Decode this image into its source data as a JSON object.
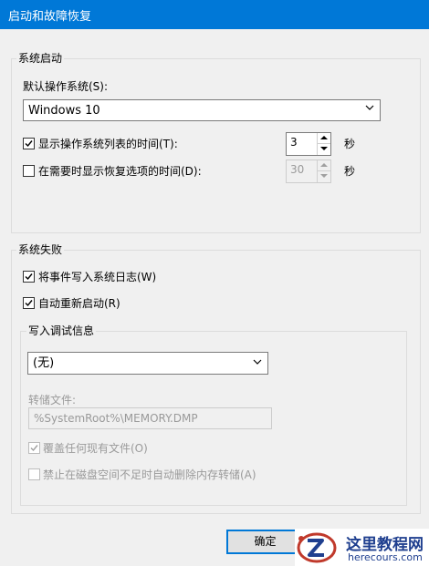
{
  "window": {
    "title": "启动和故障恢复"
  },
  "startup": {
    "legend": "系统启动",
    "default_os_label": "默认操作系统(S):",
    "default_os_value": "Windows 10",
    "show_list_label": "显示操作系统列表的时间(T):",
    "show_list_checked": true,
    "show_list_value": "3",
    "show_list_unit": "秒",
    "show_recovery_label": "在需要时显示恢复选项的时间(D):",
    "show_recovery_checked": false,
    "show_recovery_value": "30",
    "show_recovery_unit": "秒"
  },
  "failure": {
    "legend": "系统失败",
    "write_event_label": "将事件写入系统日志(W)",
    "write_event_checked": true,
    "auto_restart_label": "自动重新启动(R)",
    "auto_restart_checked": true,
    "debug": {
      "legend": "写入调试信息",
      "type_value": "(无)",
      "dump_file_label": "转储文件:",
      "dump_file_value": "%SystemRoot%\\MEMORY.DMP",
      "overwrite_label": "覆盖任何现有文件(O)",
      "overwrite_checked": true,
      "disable_auto_delete_label": "禁止在磁盘空间不足时自动删除内存转储(A)",
      "disable_auto_delete_checked": false
    }
  },
  "buttons": {
    "ok_label": "确定"
  },
  "watermark": {
    "name": "这里教程网",
    "url": "herecours.com"
  },
  "colors": {
    "titlebar": "#0078d7",
    "client": "#f0f0f0",
    "accent": "#0078d7"
  }
}
